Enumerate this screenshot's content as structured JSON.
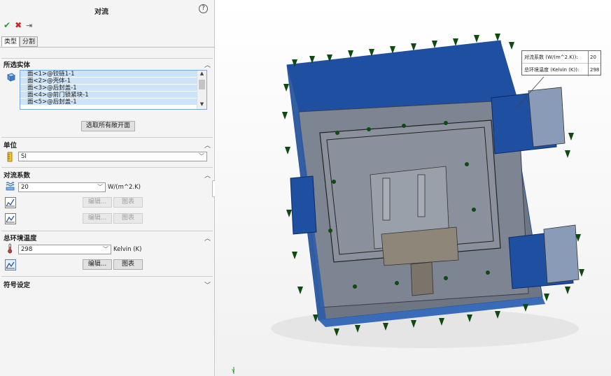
{
  "header": {
    "title": "对流",
    "help": "?"
  },
  "actions": {
    "ok": "✔",
    "cancel": "✖",
    "pin": "⇥"
  },
  "tabs": [
    {
      "label": "类型"
    },
    {
      "label": "分割"
    }
  ],
  "selected_entities": {
    "title": "所选实体",
    "items": [
      "面<1>@铰链1-1",
      "面<2>@壳体-1",
      "面<3>@后封盖-1",
      "面<4>@前门锁紧块-1",
      "面<5>@后封盖-1"
    ],
    "select_all_button": "选取所有敞开面"
  },
  "units": {
    "title": "单位",
    "value": "SI"
  },
  "convection": {
    "title": "对流系数",
    "value": "20",
    "unit": "W/(m^2.K)",
    "edit": "编辑...",
    "chart": "图表"
  },
  "ambient": {
    "title": "总环境温度",
    "value": "298",
    "unit": "Kelvin (K)",
    "edit": "编辑...",
    "chart": "图表"
  },
  "symbol": {
    "title": "符号设定"
  },
  "callout": {
    "coef_label": "对流系数 (W/(m^2.K)):",
    "coef_value": "20",
    "temp_label": "总环境温度 (Kelvin (K)):",
    "temp_value": "298"
  },
  "triad": {
    "y_label": "Y"
  },
  "colors": {
    "accent": "#1f4fa0",
    "arrow": "#0f4a12",
    "selection_fill": "#cce3f8"
  }
}
